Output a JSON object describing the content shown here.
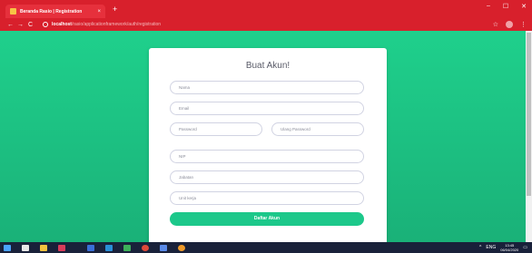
{
  "browser": {
    "tab_title": "Beranda Rasio | Registration",
    "tab_close": "×",
    "new_tab": "+",
    "window_controls": {
      "minimize": "–",
      "maximize": "☐",
      "close": "✕"
    },
    "nav": {
      "back": "←",
      "forward": "→",
      "reload": "C"
    },
    "url_host": "localhost",
    "url_path": "/rasio/applicationframework/auth/registration",
    "star": "☆",
    "menu": "⋮",
    "accent_color": "#d8202c"
  },
  "page": {
    "background_colors": [
      "#1fd08c",
      "#1ab178"
    ],
    "form": {
      "title": "Buat Akun!",
      "fields": {
        "name_placeholder": "Nama",
        "email_placeholder": "Email",
        "password_placeholder": "Password",
        "repeat_password_placeholder": "Ulang Password",
        "nip_placeholder": "NIP",
        "jabatan_placeholder": "Jabatan",
        "unit_kerja_placeholder": "Unit kerja"
      },
      "submit_label": "Daftar Akun",
      "button_color": "#1cc88a"
    }
  },
  "taskbar": {
    "icons": [
      "windows-start-icon",
      "store-icon",
      "file-explorer-icon",
      "app-icon",
      "app-icon",
      "app-icon",
      "app-icon",
      "chrome-icon",
      "app-icon",
      "app-icon"
    ],
    "tray": {
      "chevron": "^",
      "lang": "ENG",
      "time": "13:45",
      "date": "06/04/2020",
      "notification": "▭"
    }
  }
}
